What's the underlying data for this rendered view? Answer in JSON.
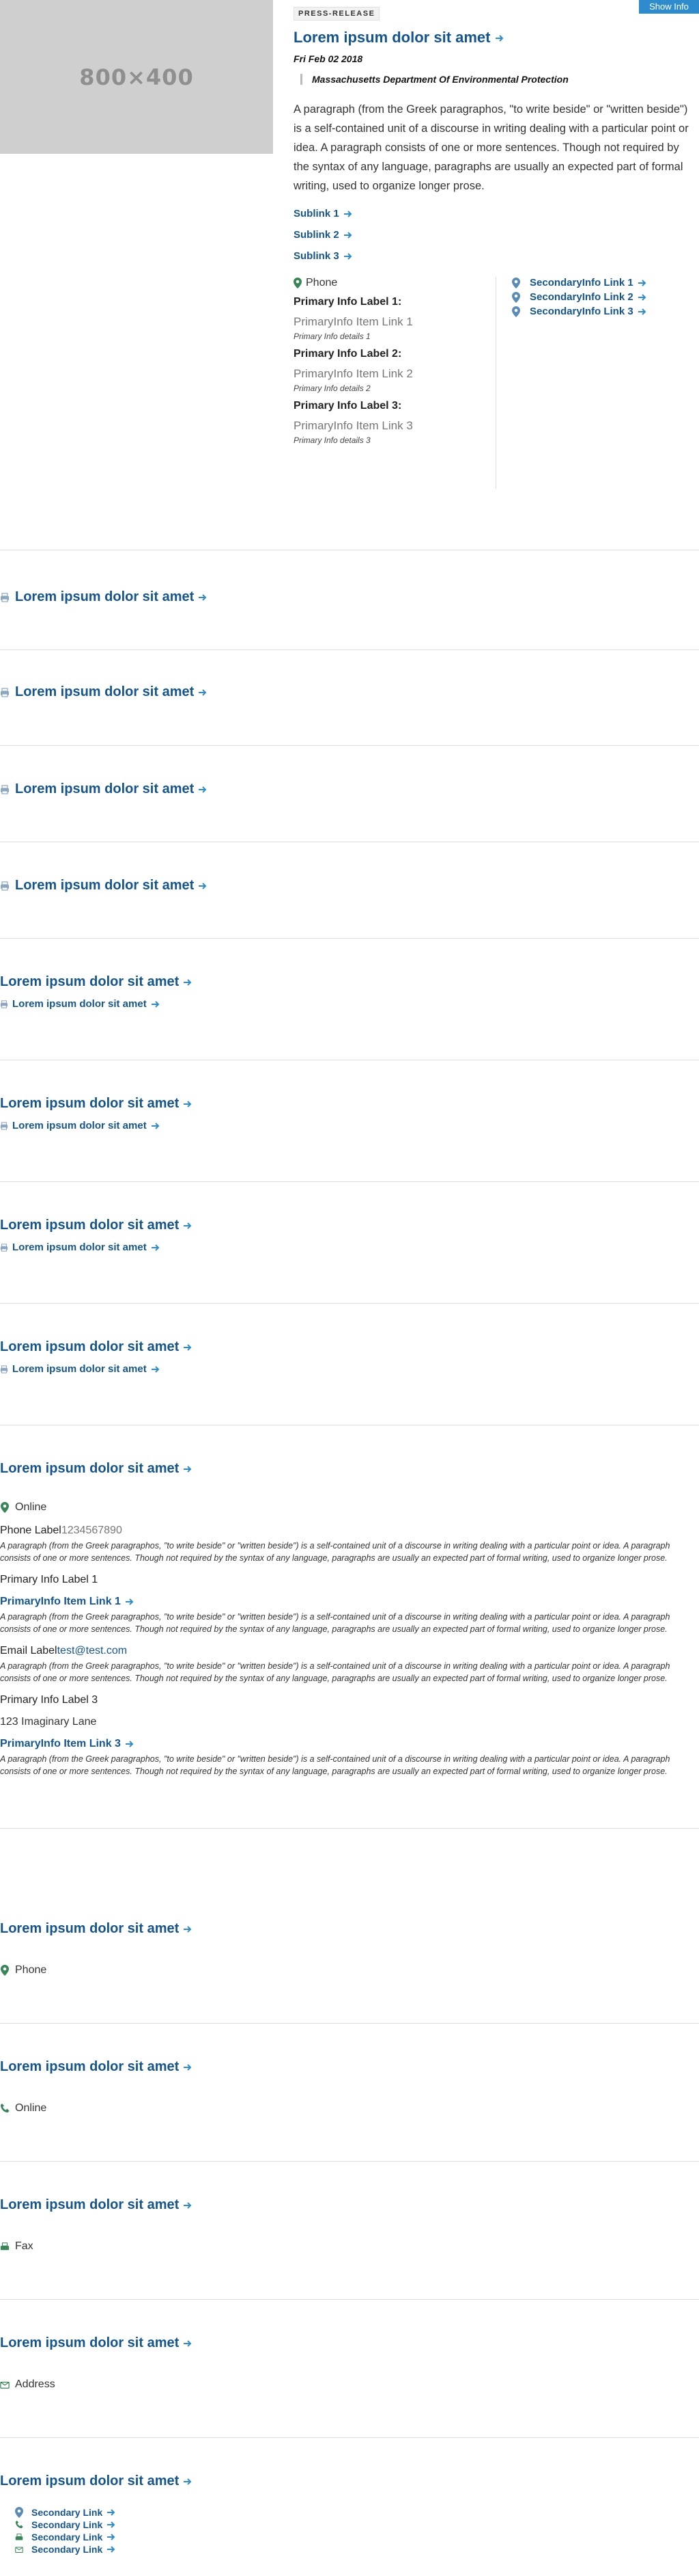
{
  "header": {
    "show_info_label": "Show Info"
  },
  "hero": {
    "image_label": "800×400",
    "badge": "PRESS-RELEASE",
    "title": "Lorem ipsum dolor sit amet",
    "date": "Fri Feb 02 2018",
    "org": "Massachusetts Department Of Environmental Protection",
    "paragraph": "A paragraph (from the Greek paragraphos, \"to write beside\" or \"written beside\") is a self-contained unit of a discourse in writing dealing with a particular point or idea. A paragraph consists of one or more sentences. Though not required by the syntax of any language, paragraphs are usually an expected part of formal writing, used to organize longer prose.",
    "sublinks": [
      "Sublink 1",
      "Sublink 2",
      "Sublink 3"
    ],
    "primary": {
      "heading": "Phone",
      "items": [
        {
          "label": "Primary Info Label 1:",
          "link": "PrimaryInfo Item Link 1",
          "details": "Primary Info details 1"
        },
        {
          "label": "Primary Info Label 2:",
          "link": "PrimaryInfo Item Link 2",
          "details": "Primary Info details 2"
        },
        {
          "label": "Primary Info Label 3:",
          "link": "PrimaryInfo Item Link 3",
          "details": "Primary Info details 3"
        }
      ]
    },
    "secondary_links": [
      "SecondaryInfo Link 1",
      "SecondaryInfo Link 2",
      "SecondaryInfo Link 3"
    ]
  },
  "simple_sections": [
    {
      "title": "Lorem ipsum dolor sit amet",
      "icon": "print-icon"
    },
    {
      "title": "Lorem ipsum dolor sit amet",
      "icon": "print-icon"
    },
    {
      "title": "Lorem ipsum dolor sit amet",
      "icon": "print-icon"
    },
    {
      "title": "Lorem ipsum dolor sit amet",
      "icon": "print-icon"
    }
  ],
  "sub_sections": [
    {
      "title": "Lorem ipsum dolor sit amet",
      "sublink": "Lorem ipsum dolor sit amet"
    },
    {
      "title": "Lorem ipsum dolor sit amet",
      "sublink": "Lorem ipsum dolor sit amet"
    },
    {
      "title": "Lorem ipsum dolor sit amet",
      "sublink": "Lorem ipsum dolor sit amet"
    },
    {
      "title": "Lorem ipsum dolor sit amet",
      "sublink": "Lorem ipsum dolor sit amet"
    }
  ],
  "detail_section": {
    "title": "Lorem ipsum dolor sit amet",
    "online": "Online",
    "phone_label": "Phone Label",
    "phone_value": "1234567890",
    "paragraph": "A paragraph (from the Greek paragraphos, \"to write beside\" or \"written beside\") is a self-contained unit of a discourse in writing dealing with a particular point or idea. A paragraph consists of one or more sentences. Though not required by the syntax of any language, paragraphs are usually an expected part of formal writing, used to organize longer prose.",
    "primary_label_1": "Primary Info Label 1",
    "primary_link_1": "PrimaryInfo Item Link 1",
    "email_label": "Email Label",
    "email_value": "test@test.com",
    "primary_label_3": "Primary Info Label 3",
    "address": "123 Imaginary Lane",
    "primary_link_3": "PrimaryInfo Item Link 3"
  },
  "contact_sections": [
    {
      "title": "Lorem ipsum dolor sit amet",
      "label": "Phone",
      "icon": "pin-icon"
    },
    {
      "title": "Lorem ipsum dolor sit amet",
      "label": "Online",
      "icon": "phone-icon"
    },
    {
      "title": "Lorem ipsum dolor sit amet",
      "label": "Fax",
      "icon": "fax-icon"
    },
    {
      "title": "Lorem ipsum dolor sit amet",
      "label": "Address",
      "icon": "address-icon"
    }
  ],
  "last_section": {
    "title": "Lorem ipsum dolor sit amet",
    "links": [
      "Secondary Link",
      "Secondary Link",
      "Secondary Link",
      "Secondary Link"
    ]
  },
  "colors": {
    "link": "#14558f",
    "pin": "#388557",
    "button": "#2e8bce"
  }
}
